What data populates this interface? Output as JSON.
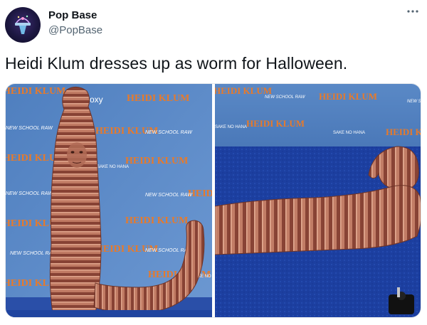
{
  "author": {
    "display_name": "Pop Base",
    "handle": "@PopBase",
    "avatar_icon": "pop-base-logo-icon"
  },
  "tweet": {
    "text": "Heidi Klum dresses up as worm for Halloween."
  },
  "actions": {
    "more_icon": "more-options-icon"
  },
  "media": {
    "photos": [
      {
        "subject": "worm-costume-standing"
      },
      {
        "subject": "worm-costume-lying"
      }
    ],
    "backdrop_text": {
      "brand": "HEIDI KLUM",
      "sponsor_1": "NEW SCHOOL RAW",
      "sponsor_2": "SAKE NO HANA",
      "sponsor_3": "moxy"
    }
  },
  "colors": {
    "backdrop_blue": "#5a86c4",
    "carpet_blue": "#1a3f9e",
    "worm_base": "#b8705c",
    "worm_ridge": "#8a4434",
    "brand_orange": "#e87a2a"
  }
}
